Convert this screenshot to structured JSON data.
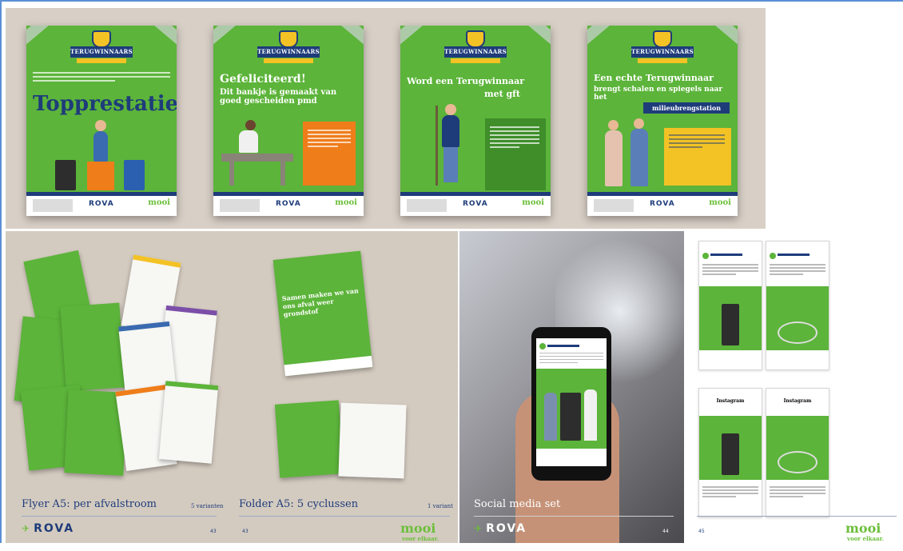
{
  "colors": {
    "brand_green": "#5cb43a",
    "brand_blue": "#1e3c7a",
    "accent_orange": "#ef7d1a",
    "accent_yellow": "#f3c224"
  },
  "posters": [
    {
      "badge": "TERUGWINNAARS",
      "title_top": "",
      "title_main": "Topprestatie",
      "footer_brand": "ROVA",
      "footer_mooi": "mooi"
    },
    {
      "badge": "TERUGWINNAARS",
      "title_top": "Gefeliciteerd!",
      "title_main": "Dit bankje is gemaakt van goed gescheiden pmd",
      "footer_brand": "ROVA",
      "footer_mooi": "mooi"
    },
    {
      "badge": "TERUGWINNAARS",
      "title_top": "Word een Terugwinnaar",
      "title_main": "met gft",
      "footer_brand": "ROVA",
      "footer_mooi": "mooi"
    },
    {
      "badge": "TERUGWINNAARS",
      "title_top": "Een echte Terugwinnaar",
      "title_main": "brengt schalen en spiegels naar het",
      "sign": "milieubrengstation",
      "footer_brand": "ROVA",
      "footer_mooi": "mooi"
    }
  ],
  "flyer": {
    "caption": "Flyer A5: per afvalstroom",
    "variants": "5 varianten",
    "page": "43"
  },
  "folder": {
    "caption": "Folder A5: 5 cyclussen",
    "variants": "1 variant",
    "page": "43",
    "cover_title": "Samen maken we van ons afval weer grondstof"
  },
  "social": {
    "caption": "Social media set",
    "page_left": "44",
    "page_right": "45",
    "post_header": "Instagram"
  },
  "logos": {
    "rova": "ROVA",
    "mooi": "mooi",
    "mooi_small": "voor elkaar."
  }
}
